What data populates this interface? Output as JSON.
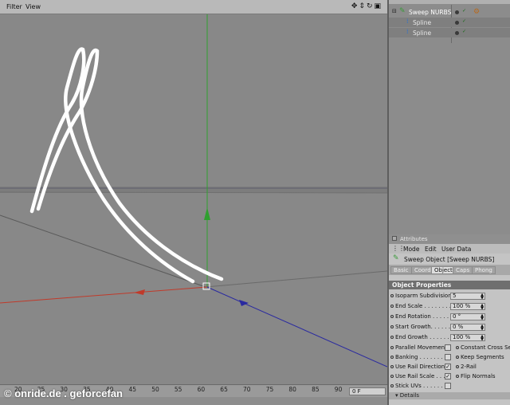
{
  "viewport": {
    "menu": [
      "Filter",
      "View"
    ],
    "nav_icons": [
      "move-icon",
      "zoom-icon",
      "rotate-icon",
      "maximize-icon"
    ]
  },
  "object_manager": {
    "objects": [
      {
        "name": "Sweep NURBS",
        "icon": "sweep-nurbs-icon",
        "level": 0,
        "selected": false
      },
      {
        "name": "Spline",
        "icon": "spline-icon",
        "level": 1,
        "selected": true
      },
      {
        "name": "Spline",
        "icon": "spline-icon",
        "level": 1,
        "selected": true
      }
    ]
  },
  "attributes": {
    "title": "Attributes",
    "menu": [
      "Mode",
      "Edit",
      "User Data"
    ],
    "object_label": "Sweep Object [Sweep NURBS]",
    "tabs": [
      "Basic",
      "Coord.",
      "Object",
      "Caps",
      "Phong"
    ],
    "active_tab": "Object",
    "section": "Object Properties",
    "fields": [
      {
        "label": "Isoparm Subdivision",
        "value": "5"
      },
      {
        "label": "End Scale . . . . . . . .",
        "value": "100 %"
      },
      {
        "label": "End Rotation . . . . . .",
        "value": "0 °"
      },
      {
        "label": "Start Growth. . . . . . .",
        "value": "0 %"
      },
      {
        "label": "End Growth . . . . . . .",
        "value": "100 %"
      }
    ],
    "checks_left": [
      {
        "label": "Parallel Movement",
        "checked": false
      },
      {
        "label": "Banking . . . . . . . .",
        "checked": false
      },
      {
        "label": "Use Rail Direction",
        "checked": true
      },
      {
        "label": "Use Rail Scale . . .",
        "checked": true
      },
      {
        "label": "Stick UVs . . . . . .",
        "checked": false
      }
    ],
    "checks_right": [
      {
        "label": "Constant Cross Se"
      },
      {
        "label": "Keep Segments"
      },
      {
        "label": "2-Rail"
      },
      {
        "label": "Flip Normals"
      }
    ],
    "details": "Details"
  },
  "timeline": {
    "ticks": [
      "20",
      "25",
      "30",
      "35",
      "40",
      "45",
      "50",
      "55",
      "60",
      "65",
      "70",
      "75",
      "80",
      "85",
      "90"
    ],
    "frame": "0 F"
  },
  "credit": "© onride.de . geforcefan",
  "colors": {
    "viewport_bg": "#888888",
    "axis_x": "#c03a2a",
    "axis_y": "#2fa02f",
    "axis_z": "#2a2aa0",
    "spline": "#ffffff"
  }
}
